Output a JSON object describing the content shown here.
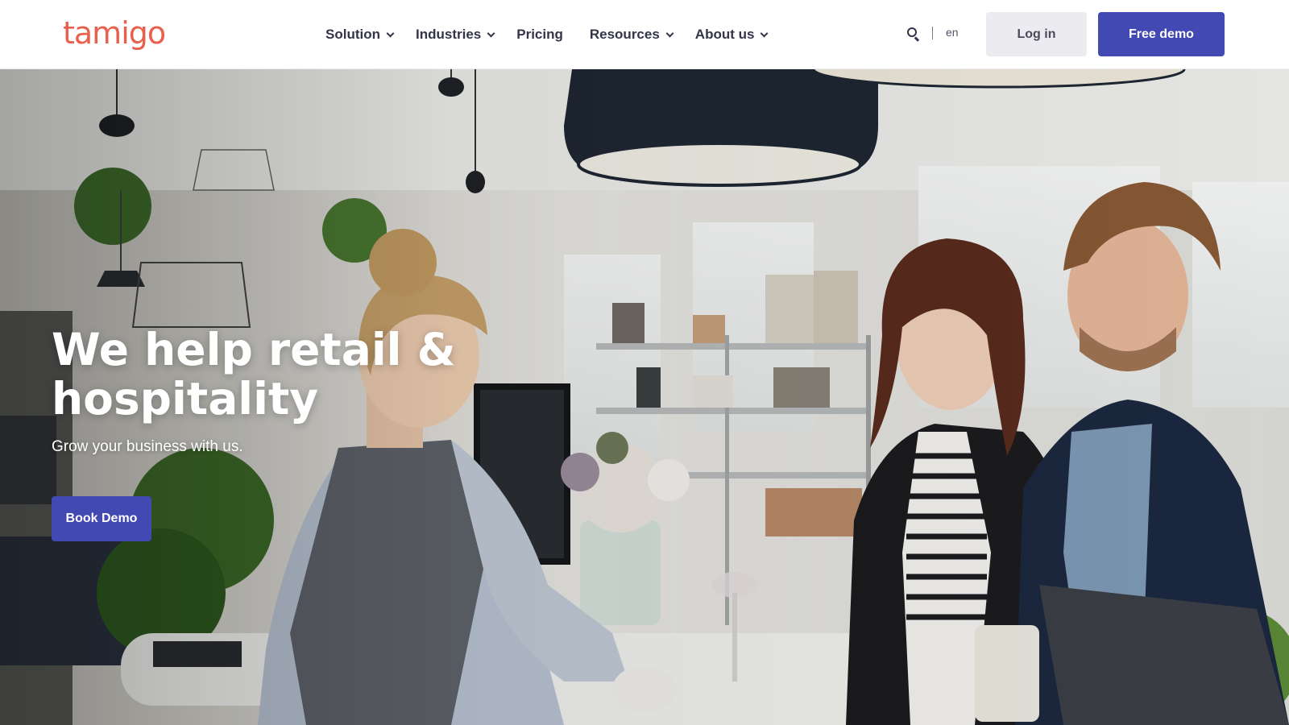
{
  "header": {
    "logo_text": "tamigo",
    "nav": [
      {
        "label": "Solution",
        "has_dropdown": true
      },
      {
        "label": "Industries",
        "has_dropdown": true
      },
      {
        "label": "Pricing",
        "has_dropdown": false
      },
      {
        "label": "Resources",
        "has_dropdown": true
      },
      {
        "label": "About us",
        "has_dropdown": true
      }
    ],
    "search_icon": "search-icon",
    "language": "en",
    "login_label": "Log in",
    "demo_label": "Free demo"
  },
  "hero": {
    "title": "We help retail & hospitality",
    "subtitle": "Grow your business with us.",
    "cta_label": "Book Demo",
    "image_description": "retail-store-checkout-photo"
  },
  "colors": {
    "brand_orange": "#e8604e",
    "primary_button": "#4349b2",
    "secondary_button": "#ececf0",
    "nav_text": "#33334a"
  }
}
